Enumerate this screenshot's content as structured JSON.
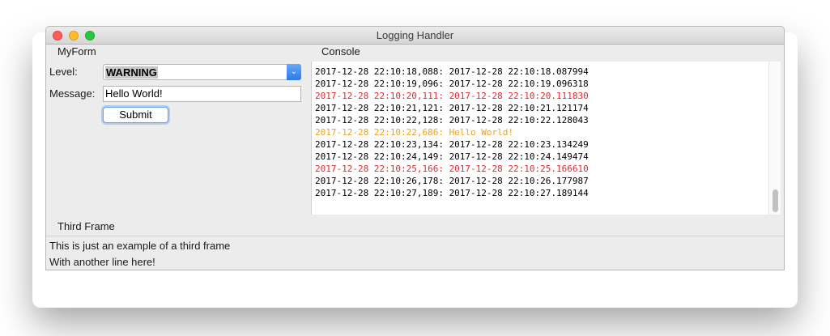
{
  "window": {
    "title": "Logging Handler"
  },
  "form": {
    "frame_label": "MyForm",
    "level_label": "Level:",
    "level_value": "WARNING",
    "message_label": "Message:",
    "message_value": "Hello World!",
    "submit_label": "Submit"
  },
  "console": {
    "frame_label": "Console",
    "colors": {
      "normal": "#000000",
      "error": "#e8262b",
      "warning": "#f0a21b"
    },
    "lines": [
      {
        "text": "2017-12-28 22:10:18,088: 2017-12-28 22:10:18.087994",
        "level": "normal"
      },
      {
        "text": "2017-12-28 22:10:19,096: 2017-12-28 22:10:19.096318",
        "level": "normal"
      },
      {
        "text": "2017-12-28 22:10:20,111: 2017-12-28 22:10:20.111830",
        "level": "error"
      },
      {
        "text": "2017-12-28 22:10:21,121: 2017-12-28 22:10:21.121174",
        "level": "normal"
      },
      {
        "text": "2017-12-28 22:10:22,128: 2017-12-28 22:10:22.128043",
        "level": "normal"
      },
      {
        "text": "2017-12-28 22:10:22,686: Hello World!",
        "level": "warning"
      },
      {
        "text": "2017-12-28 22:10:23,134: 2017-12-28 22:10:23.134249",
        "level": "normal"
      },
      {
        "text": "2017-12-28 22:10:24,149: 2017-12-28 22:10:24.149474",
        "level": "normal"
      },
      {
        "text": "2017-12-28 22:10:25,166: 2017-12-28 22:10:25.166610",
        "level": "error"
      },
      {
        "text": "2017-12-28 22:10:26,178: 2017-12-28 22:10:26.177987",
        "level": "normal"
      },
      {
        "text": "2017-12-28 22:10:27,189: 2017-12-28 22:10:27.189144",
        "level": "normal"
      }
    ]
  },
  "third_frame": {
    "frame_label": "Third Frame",
    "line1": "This is just an example of a third frame",
    "line2": "With another line here!"
  }
}
